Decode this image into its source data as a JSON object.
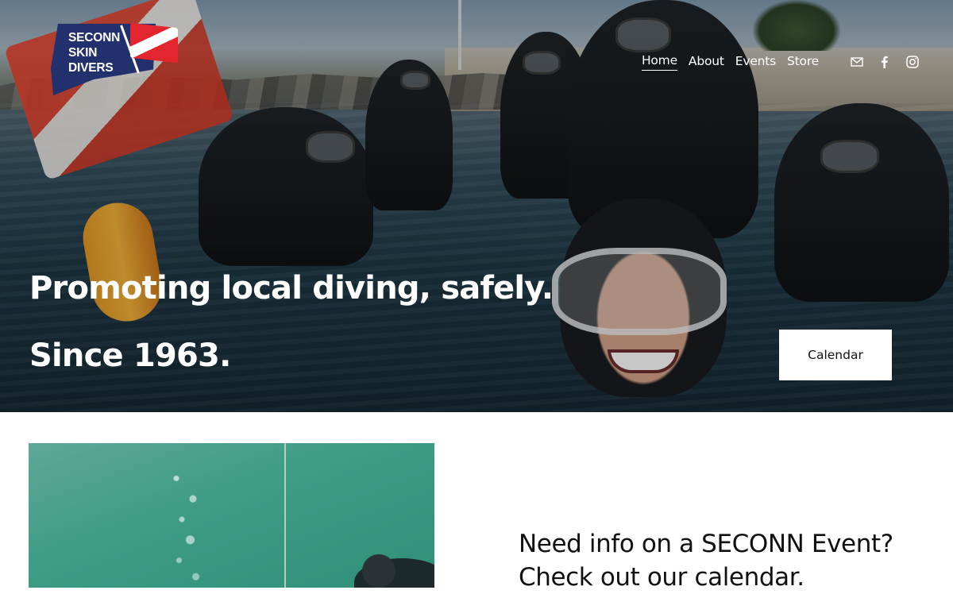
{
  "site": {
    "logo_text": [
      "SECONN",
      "SKIN",
      "DIVERS"
    ]
  },
  "nav": {
    "items": [
      {
        "label": "Home",
        "active": true
      },
      {
        "label": "About",
        "active": false
      },
      {
        "label": "Events",
        "active": false
      },
      {
        "label": "Store",
        "active": false
      }
    ],
    "icons": [
      "mail-icon",
      "facebook-icon",
      "instagram-icon"
    ]
  },
  "hero": {
    "line1": "Promoting local diving, safely.",
    "line2": "Since 1963.",
    "button_label": "Calendar"
  },
  "section2": {
    "heading_line1": "Need info on a SECONN Event?",
    "heading_line2": "Check out our calendar."
  },
  "colors": {
    "logo_blue": "#23306e",
    "dive_flag_red": "#e3262e",
    "button_bg": "#ffffff",
    "text_dark": "#111111"
  }
}
